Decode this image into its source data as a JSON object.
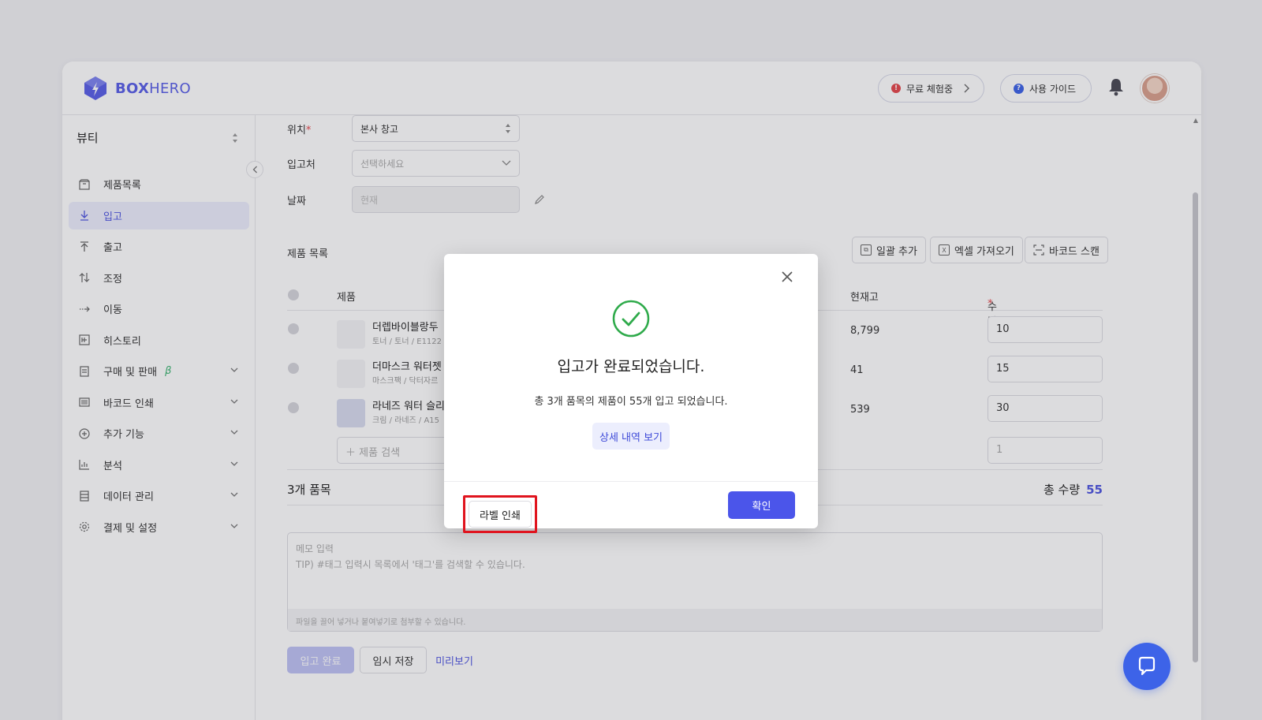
{
  "header": {
    "logo_text_bold": "BOX",
    "logo_text_light": "HERO",
    "trial_label": "무료 체험중",
    "guide_label": "사용 가이드"
  },
  "sidebar": {
    "workspace": "뷰티",
    "items": [
      {
        "label": "제품목록",
        "icon": "box-icon"
      },
      {
        "label": "입고",
        "icon": "arrow-down-icon",
        "active": true
      },
      {
        "label": "출고",
        "icon": "arrow-up-icon"
      },
      {
        "label": "조정",
        "icon": "swap-icon"
      },
      {
        "label": "이동",
        "icon": "move-icon"
      },
      {
        "label": "히스토리",
        "icon": "history-icon"
      },
      {
        "label": "구매 및 판매",
        "icon": "document-icon",
        "beta": "β",
        "expandable": true
      },
      {
        "label": "바코드 인쇄",
        "icon": "barcode-icon",
        "expandable": true
      },
      {
        "label": "추가 기능",
        "icon": "plus-circle-icon",
        "expandable": true
      },
      {
        "label": "분석",
        "icon": "chart-icon",
        "expandable": true
      },
      {
        "label": "데이터 관리",
        "icon": "database-icon",
        "expandable": true
      },
      {
        "label": "결제 및 설정",
        "icon": "gear-icon",
        "expandable": true
      }
    ]
  },
  "form": {
    "location_label": "위치",
    "location_value": "본사 창고",
    "supplier_label": "입고처",
    "supplier_placeholder": "선택하세요",
    "date_label": "날짜",
    "date_placeholder": "현재"
  },
  "products": {
    "section_title": "제품 목록",
    "bulk_add": "일괄 추가",
    "excel_import": "엑셀 가져오기",
    "barcode_scan": "바코드 스캔",
    "col_product": "제품",
    "col_stock": "현재고",
    "col_qty": "수량",
    "rows": [
      {
        "name": "더렙바이블랑두",
        "sub": "토너 / 토너 / E1122",
        "stock": "8,799",
        "qty": "10"
      },
      {
        "name": "더마스크 워터젯",
        "sub": "마스크팩 / 닥터자르",
        "stock": "41",
        "qty": "15"
      },
      {
        "name": "라네즈 워터 슬리",
        "sub": "크림 / 라네즈 / A15",
        "stock": "539",
        "qty": "30"
      }
    ],
    "search_placeholder": "제품 검색",
    "qty_placeholder": "1",
    "summary_left": "3개 품목",
    "summary_total_label": "총 수량",
    "summary_total_value": "55"
  },
  "memo": {
    "placeholder_line1": "메모 입력",
    "placeholder_line2": "TIP) #태그 입력시 목록에서 '태그'를 검색할 수 있습니다.",
    "attach_hint": "파일을 끌어 넣거나 붙여넣기로 첨부할 수 있습니다."
  },
  "actions": {
    "complete": "입고 완료",
    "draft": "임시 저장",
    "preview": "미리보기"
  },
  "modal": {
    "title": "입고가 완료되었습니다.",
    "description": "총 3개 품목의 제품이 55개 입고 되었습니다.",
    "detail_button": "상세 내역 보기",
    "label_print_button": "라벨 인쇄",
    "confirm_button": "확인"
  },
  "colors": {
    "brand": "#4b55ea",
    "success": "#2eaa4a",
    "highlight": "#e0141e"
  }
}
